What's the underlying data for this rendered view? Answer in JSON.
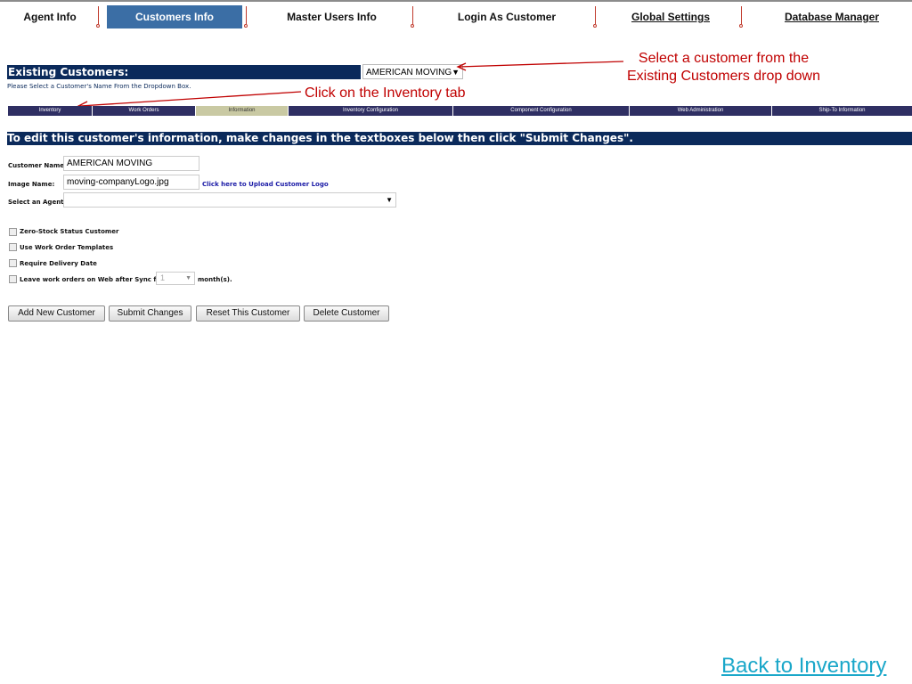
{
  "topnav": {
    "items": [
      {
        "label": "Agent Info"
      },
      {
        "label": "Customers Info"
      },
      {
        "label": "Master Users Info"
      },
      {
        "label": "Login As Customer"
      },
      {
        "label": "Global Settings"
      },
      {
        "label": "Database Manager"
      }
    ]
  },
  "existing": {
    "title": "Existing Customers:",
    "selected_customer": "AMERICAN MOVING",
    "hint": "Please Select a Customer's Name From the Dropdown Box."
  },
  "annotations": {
    "select_line1": "Select a customer from the",
    "select_line2": "Existing Customers drop down",
    "inventory_tab": "Click on the Inventory tab"
  },
  "subtabs": [
    {
      "label": "Inventory"
    },
    {
      "label": "Work Orders"
    },
    {
      "label": "Information"
    },
    {
      "label": "Inventory Configuration"
    },
    {
      "label": "Component Configuration"
    },
    {
      "label": "Web Administration"
    },
    {
      "label": "Ship-To Information"
    }
  ],
  "edit": {
    "title": "To edit this customer's information, make changes in the textboxes below then click \"Submit Changes\"."
  },
  "form": {
    "customer_name_label": "Customer Name:",
    "customer_name_value": "AMERICAN MOVING",
    "image_name_label": "Image Name:",
    "image_name_value": "moving-companyLogo.jpg",
    "upload_link": "Click here to Upload Customer Logo",
    "agent_label": "Select an Agent:",
    "agent_value": "",
    "checkboxes": [
      {
        "label": "Zero-Stock Status Customer"
      },
      {
        "label": "Use Work Order Templates"
      },
      {
        "label": "Require Delivery Date"
      },
      {
        "label": "Leave work orders on Web after Sync for"
      }
    ],
    "months_value": "1",
    "months_suffix": "month(s)."
  },
  "buttons": {
    "add": "Add New Customer",
    "submit": "Submit Changes",
    "reset": "Reset This Customer",
    "delete": "Delete Customer"
  },
  "back_link": "Back to Inventory "
}
